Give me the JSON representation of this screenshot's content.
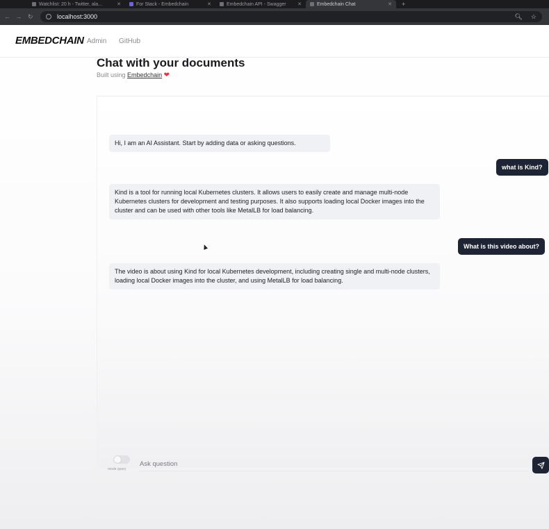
{
  "browser": {
    "tabs": [
      {
        "label": "Watchlist: 20 h - Twitter, ala..."
      },
      {
        "label": "For Stack - Embedchain"
      },
      {
        "label": "Embedchain API - Swagger"
      },
      {
        "label": "Embedchain Chat"
      }
    ],
    "url": "localhost:3000"
  },
  "nav": {
    "logo": "EMBEDCHAIN",
    "links": [
      {
        "label": "Admin"
      },
      {
        "label": "GitHub"
      }
    ]
  },
  "header": {
    "title": "Chat with your documents",
    "subtitle_prefix": "Built using",
    "subtitle_link": "Embedchain",
    "heart": "❤"
  },
  "messages": [
    {
      "role": "ai",
      "text": "Hi, I am an AI Assistant. Start by adding data or asking questions."
    },
    {
      "role": "user",
      "text": "what is Kind?"
    },
    {
      "role": "ai",
      "text": "Kind is a tool for running local Kubernetes clusters. It allows users to easily create and manage multi-node Kubernetes clusters for development and testing purposes. It also supports loading local Docker images into the cluster and can be used with other tools like MetalLB for load balancing."
    },
    {
      "role": "user",
      "text": "What is this video about?"
    },
    {
      "role": "ai",
      "text": "The video is about using Kind for local Kubernetes development, including creating single and multi-node clusters, loading local Docker images into the cluster, and using MetalLB for load balancing."
    }
  ],
  "input": {
    "toggle_label": "mode query",
    "toggle_on": false,
    "placeholder": "Ask question",
    "value": ""
  },
  "colors": {
    "accent": "#1e2433",
    "ai_bubble": "#eff1f5",
    "heart": "#e0384a"
  }
}
